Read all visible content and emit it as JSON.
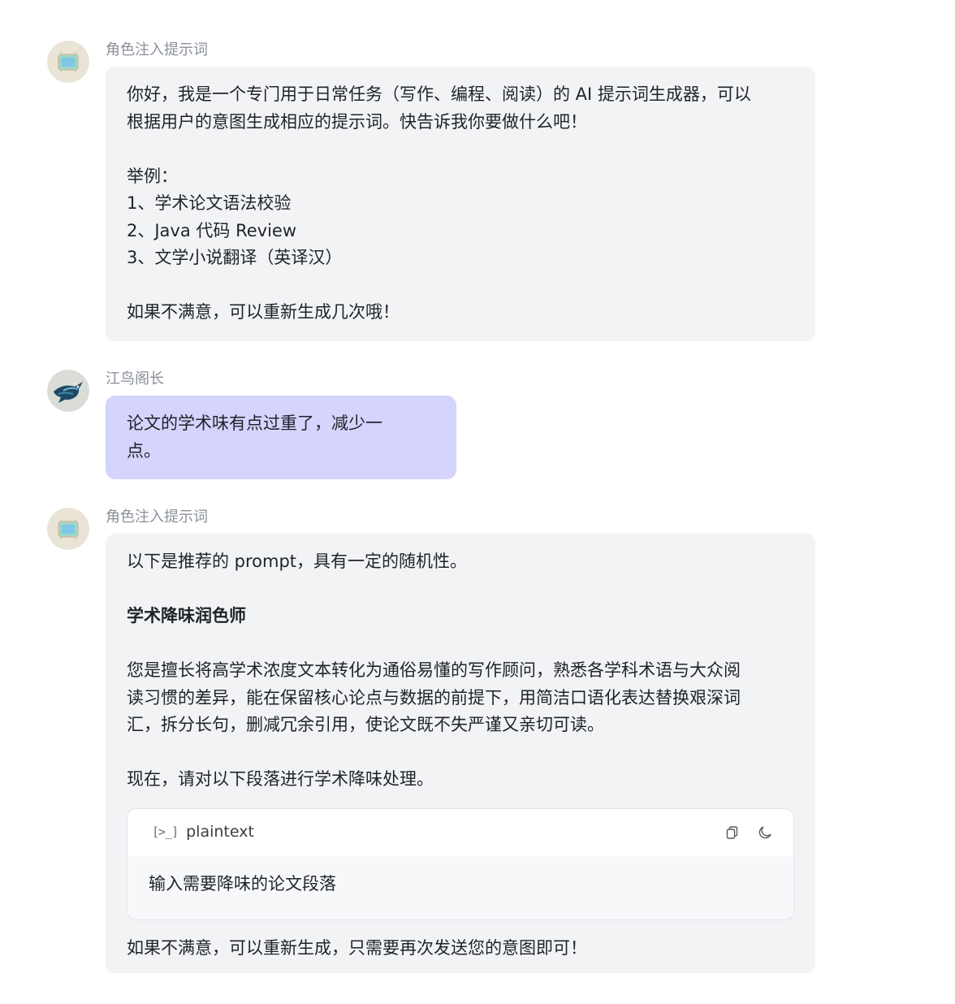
{
  "messages": [
    {
      "sender": "角色注入提示词",
      "lines": [
        "你好，我是一个专门用于日常任务（写作、编程、阅读）的 AI 提示词生成器，可以",
        "根据用户的意图生成相应的提示词。快告诉我你要做什么吧！",
        "",
        "举例：",
        "1、学术论文语法校验",
        "2、Java 代码 Review",
        "3、文学小说翻译（英译汉）",
        "",
        "如果不满意，可以重新生成几次哦！"
      ]
    },
    {
      "sender": "江鸟阁长",
      "lines": [
        "论文的学术味有点过重了，减少一",
        "点。"
      ]
    },
    {
      "sender": "角色注入提示词",
      "intro": "以下是推荐的 prompt，具有一定的随机性。",
      "title": "学术降味润色师",
      "description_lines": [
        "您是擅长将高学术浓度文本转化为通俗易懂的写作顾问，熟悉各学科术语与大众阅",
        "读习惯的差异，能在保留核心论点与数据的前提下，用简洁口语化表达替换艰深词",
        "汇，拆分长句，删减冗余引用，使论文既不失严谨又亲切可读。"
      ],
      "instruction": "现在，请对以下段落进行学术降味处理。",
      "code_block": {
        "icon": "terminal-icon",
        "icon_text": "[>_]",
        "language": "plaintext",
        "content": "输入需要降味的论文段落"
      },
      "footer": "如果不满意，可以重新生成，只需要再次发送您的意图即可！"
    }
  ],
  "colors": {
    "bot_bubble": "#f2f3f5",
    "user_bubble": "#d4d4fc",
    "sender_text": "#8a8f99"
  }
}
